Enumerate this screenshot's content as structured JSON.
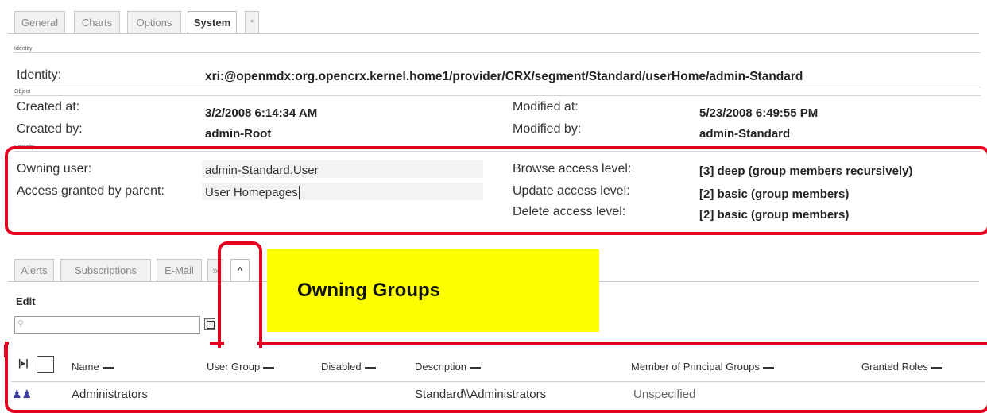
{
  "top_tabs": [
    "General",
    "Charts",
    "Options",
    "System",
    "*"
  ],
  "sections": {
    "identity": {
      "label": "Identity",
      "identity_label": "Identity:",
      "identity_value": "xri:@openmdx:org.opencrx.kernel.home1/provider/CRX/segment/Standard/userHome/admin-Standard"
    },
    "object": {
      "label": "Object",
      "created_at_label": "Created at:",
      "created_at_value": "3/2/2008 6:14:34 AM",
      "created_by_label": "Created by:",
      "created_by_value": "admin-Root",
      "modified_at_label": "Modified at:",
      "modified_at_value": "5/23/2008 6:49:55 PM",
      "modified_by_label": "Modified by:",
      "modified_by_value": "admin-Standard"
    },
    "security": {
      "label": "Security",
      "owning_user_label": "Owning user:",
      "owning_user_value": "admin-Standard.User",
      "access_parent_label": "Access granted by parent:",
      "access_parent_value": "User Homepages",
      "browse_label": "Browse access level:",
      "browse_value": "[3] deep (group members recursively)",
      "update_label": "Update access level:",
      "update_value": "[2] basic (group members)",
      "delete_label": "Delete access level:",
      "delete_value": "[2] basic (group members)"
    }
  },
  "bottom_tabs": [
    "Alerts",
    "Subscriptions",
    "E-Mail",
    "»",
    "^"
  ],
  "edit_label": "Edit",
  "callout": "Owning Groups",
  "grid": {
    "headers": [
      "Name",
      "User Group",
      "Disabled",
      "Description",
      "Member of Principal Groups",
      "Granted Roles"
    ],
    "rows": [
      {
        "name": "Administrators",
        "user_group": "",
        "disabled": "",
        "description": "Standard\\\\Administrators",
        "member_of": "Unspecified",
        "granted_roles": ""
      }
    ]
  },
  "colors": {
    "highlight_border": "#e6001f",
    "callout_bg": "#ffff00"
  }
}
